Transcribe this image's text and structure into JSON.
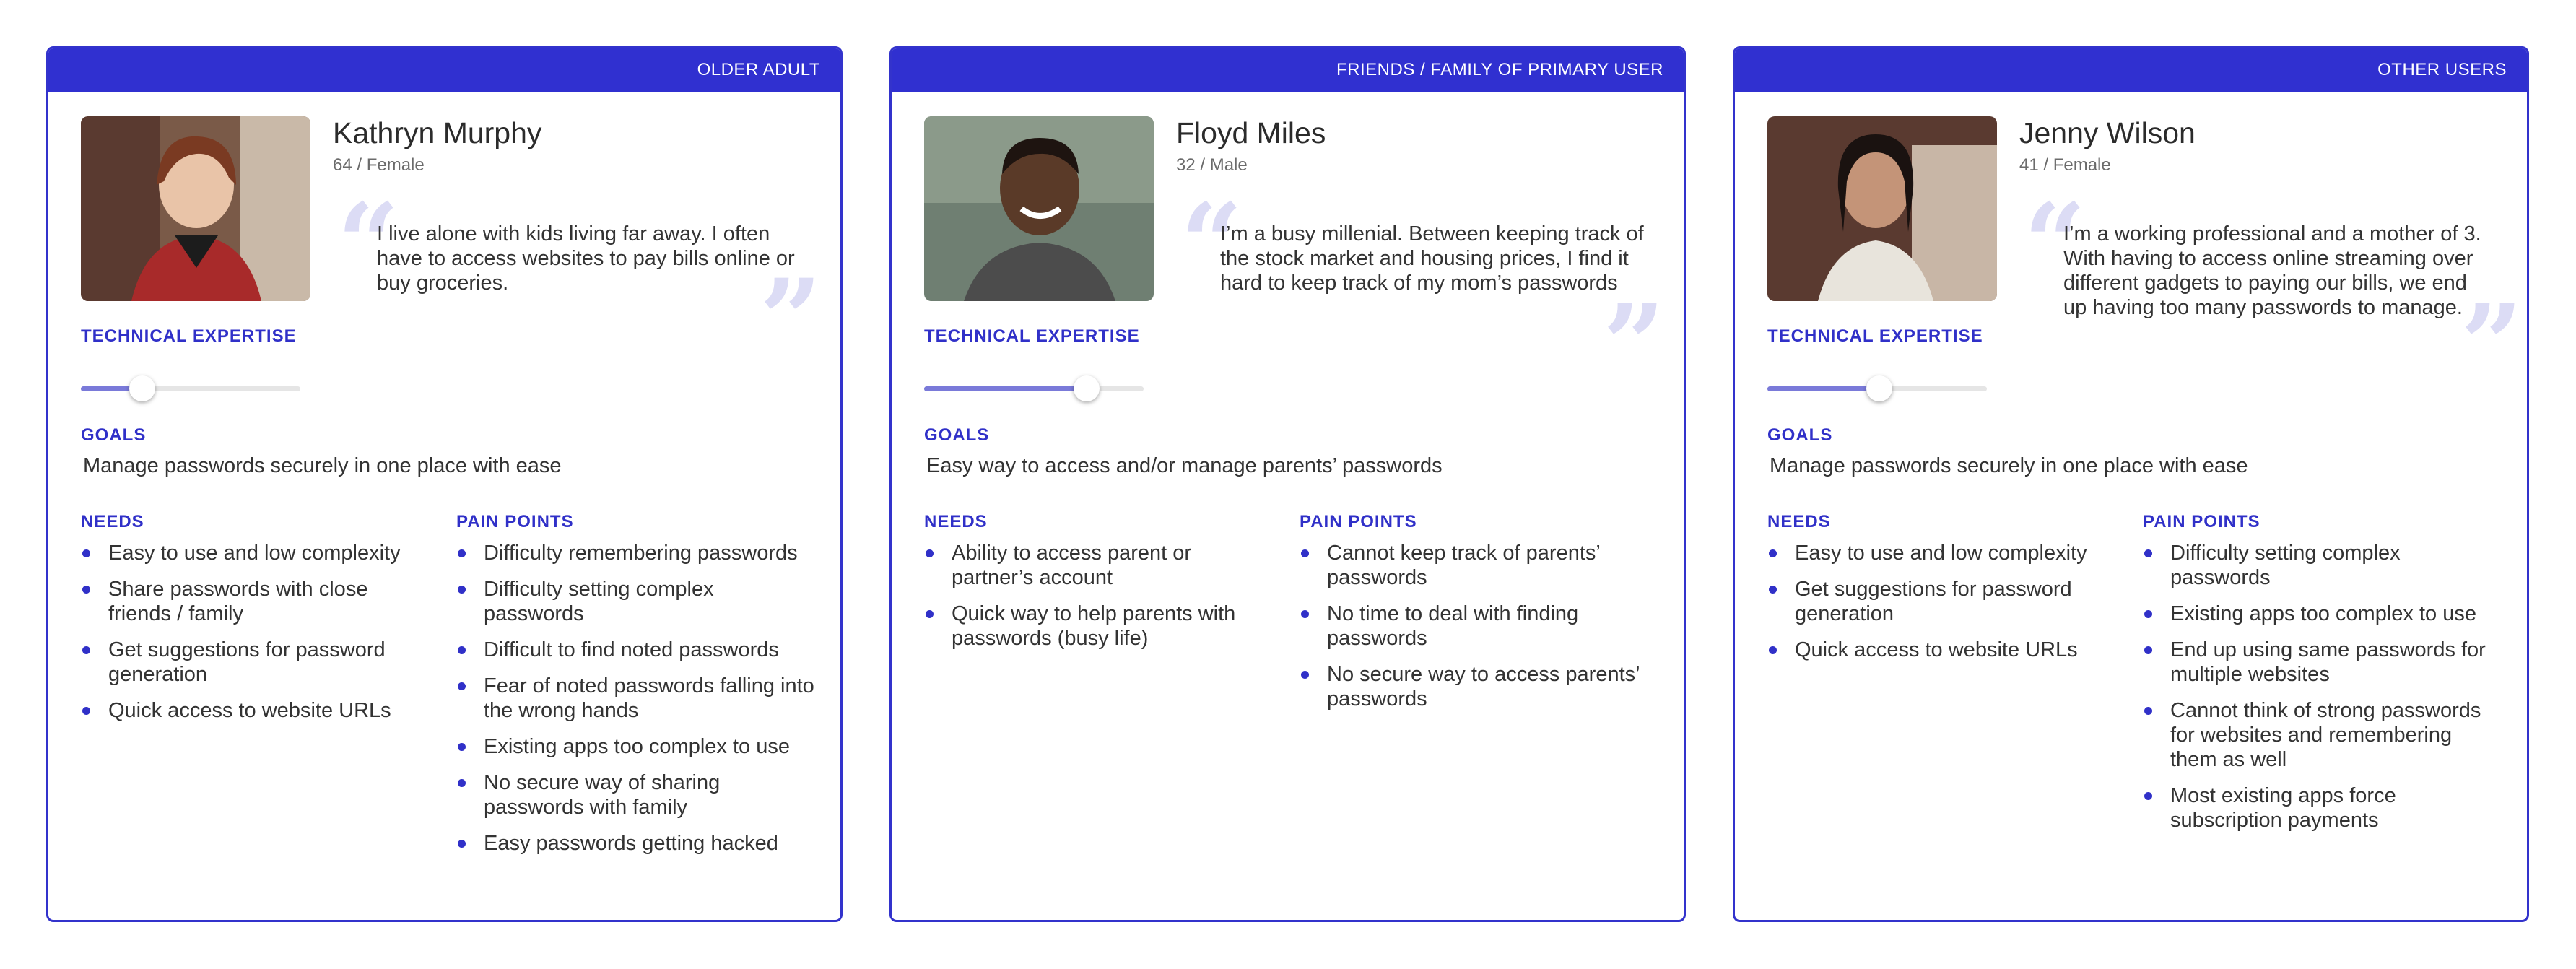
{
  "personas": [
    {
      "tag": "OLDER ADULT",
      "name": "Kathryn Murphy",
      "meta": "64 / Female",
      "quote": "I live alone with kids living far away. I often have to access websites to pay bills online or buy groceries.",
      "expertise_label": "TECHNICAL EXPERTISE",
      "expertise_level": 0.28,
      "goals_label": "GOALS",
      "goals": "Manage passwords securely in one place with ease",
      "needs_label": "NEEDS",
      "needs": [
        "Easy to use and low complexity",
        "Share passwords with close friends / family",
        "Get suggestions for password generation",
        "Quick access to website URLs"
      ],
      "pain_label": "PAIN POINTS",
      "pain_points": [
        "Difficulty remembering passwords",
        "Difficulty setting complex passwords",
        "Difficult to find noted passwords",
        "Fear of noted passwords falling into the wrong hands",
        "Existing apps too complex to use",
        "No secure way of sharing passwords with family",
        "Easy passwords getting hacked"
      ]
    },
    {
      "tag": "FRIENDS / FAMILY OF PRIMARY USER",
      "name": "Floyd Miles",
      "meta": "32 / Male",
      "quote": "I’m a busy millenial. Between keeping track of the stock market and housing prices, I find it hard to keep track of my mom’s passwords",
      "expertise_label": "TECHNICAL EXPERTISE",
      "expertise_level": 0.74,
      "goals_label": "GOALS",
      "goals": "Easy way to access and/or manage parents’ passwords",
      "needs_label": "NEEDS",
      "needs": [
        "Ability to access parent or partner’s account",
        "Quick way to help parents with passwords (busy life)"
      ],
      "pain_label": "PAIN POINTS",
      "pain_points": [
        "Cannot keep track of parents’ passwords",
        "No time to deal with finding passwords",
        "No secure way to access parents’ passwords"
      ]
    },
    {
      "tag": "OTHER USERS",
      "name": "Jenny Wilson",
      "meta": "41 / Female",
      "quote": "I’m a working professional and a mother of 3. With having to access online streaming over different gadgets to paying our bills, we end up having too many passwords to manage.",
      "expertise_label": "TECHNICAL EXPERTISE",
      "expertise_level": 0.51,
      "goals_label": "GOALS",
      "goals": "Manage passwords securely in one place with ease",
      "needs_label": "NEEDS",
      "needs": [
        "Easy to use and low complexity",
        "Get suggestions for password generation",
        "Quick access to website URLs"
      ],
      "pain_label": "PAIN POINTS",
      "pain_points": [
        "Difficulty setting complex passwords",
        "Existing apps too complex to use",
        "End up using same passwords for multiple websites",
        "Cannot think of strong passwords for websites and remembering them as well",
        "Most existing apps force subscription payments"
      ]
    }
  ],
  "colors": {
    "accent": "#3030d0",
    "muted_fill": "#7a7ad9",
    "quote_mark": "#dcdcf5"
  }
}
